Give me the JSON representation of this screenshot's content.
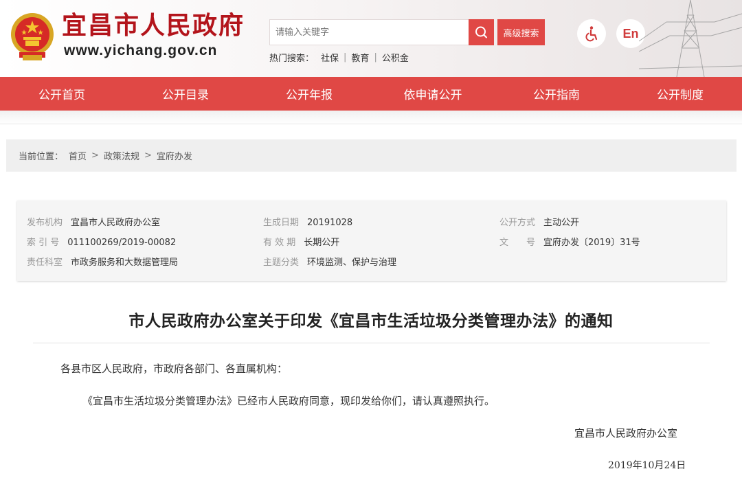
{
  "header": {
    "site_title": "宜昌市人民政府",
    "site_url": "www.yichang.gov.cn",
    "search": {
      "placeholder": "请输入关键字",
      "advanced_label": "高级搜索"
    },
    "hot": {
      "label": "热门搜索：",
      "items": [
        "社保",
        "教育",
        "公积金"
      ]
    },
    "lang_label": "En",
    "icons": {
      "search": "search-icon",
      "accessibility": "wheelchair-icon",
      "emblem": "national-emblem-icon"
    }
  },
  "nav": {
    "items": [
      "公开首页",
      "公开目录",
      "公开年报",
      "依申请公开",
      "公开指南",
      "公开制度"
    ]
  },
  "breadcrumb": {
    "label": "当前位置：",
    "items": [
      "首页",
      "政策法规",
      "宜府办发"
    ],
    "separator": ">"
  },
  "meta": {
    "rows": [
      [
        {
          "key": "发布机构",
          "value": "宜昌市人民政府办公室"
        },
        {
          "key": "生成日期",
          "value": "20191028"
        },
        {
          "key": "公开方式",
          "value": "主动公开"
        }
      ],
      [
        {
          "key": "索 引 号",
          "value": "011100269/2019-00082"
        },
        {
          "key": "有 效 期",
          "value": "长期公开"
        },
        {
          "key": "文　　号",
          "value": "宜府办发〔2019〕31号"
        }
      ],
      [
        {
          "key": "责任科室",
          "value": "市政务服务和大数据管理局"
        },
        {
          "key": "主题分类",
          "value": "环境监测、保护与治理"
        }
      ]
    ]
  },
  "document": {
    "title": "市人民政府办公室关于印发《宜昌市生活垃圾分类管理办法》的通知",
    "salutation": "各县市区人民政府，市政府各部门、各直属机构：",
    "body": "《宜昌市生活垃圾分类管理办法》已经市人民政府同意，现印发给你们，请认真遵照执行。",
    "signature": "宜昌市人民政府办公室",
    "date": "2019年10月24日"
  },
  "colors": {
    "brand_red": "#e04845",
    "title_red": "#b3141b"
  }
}
